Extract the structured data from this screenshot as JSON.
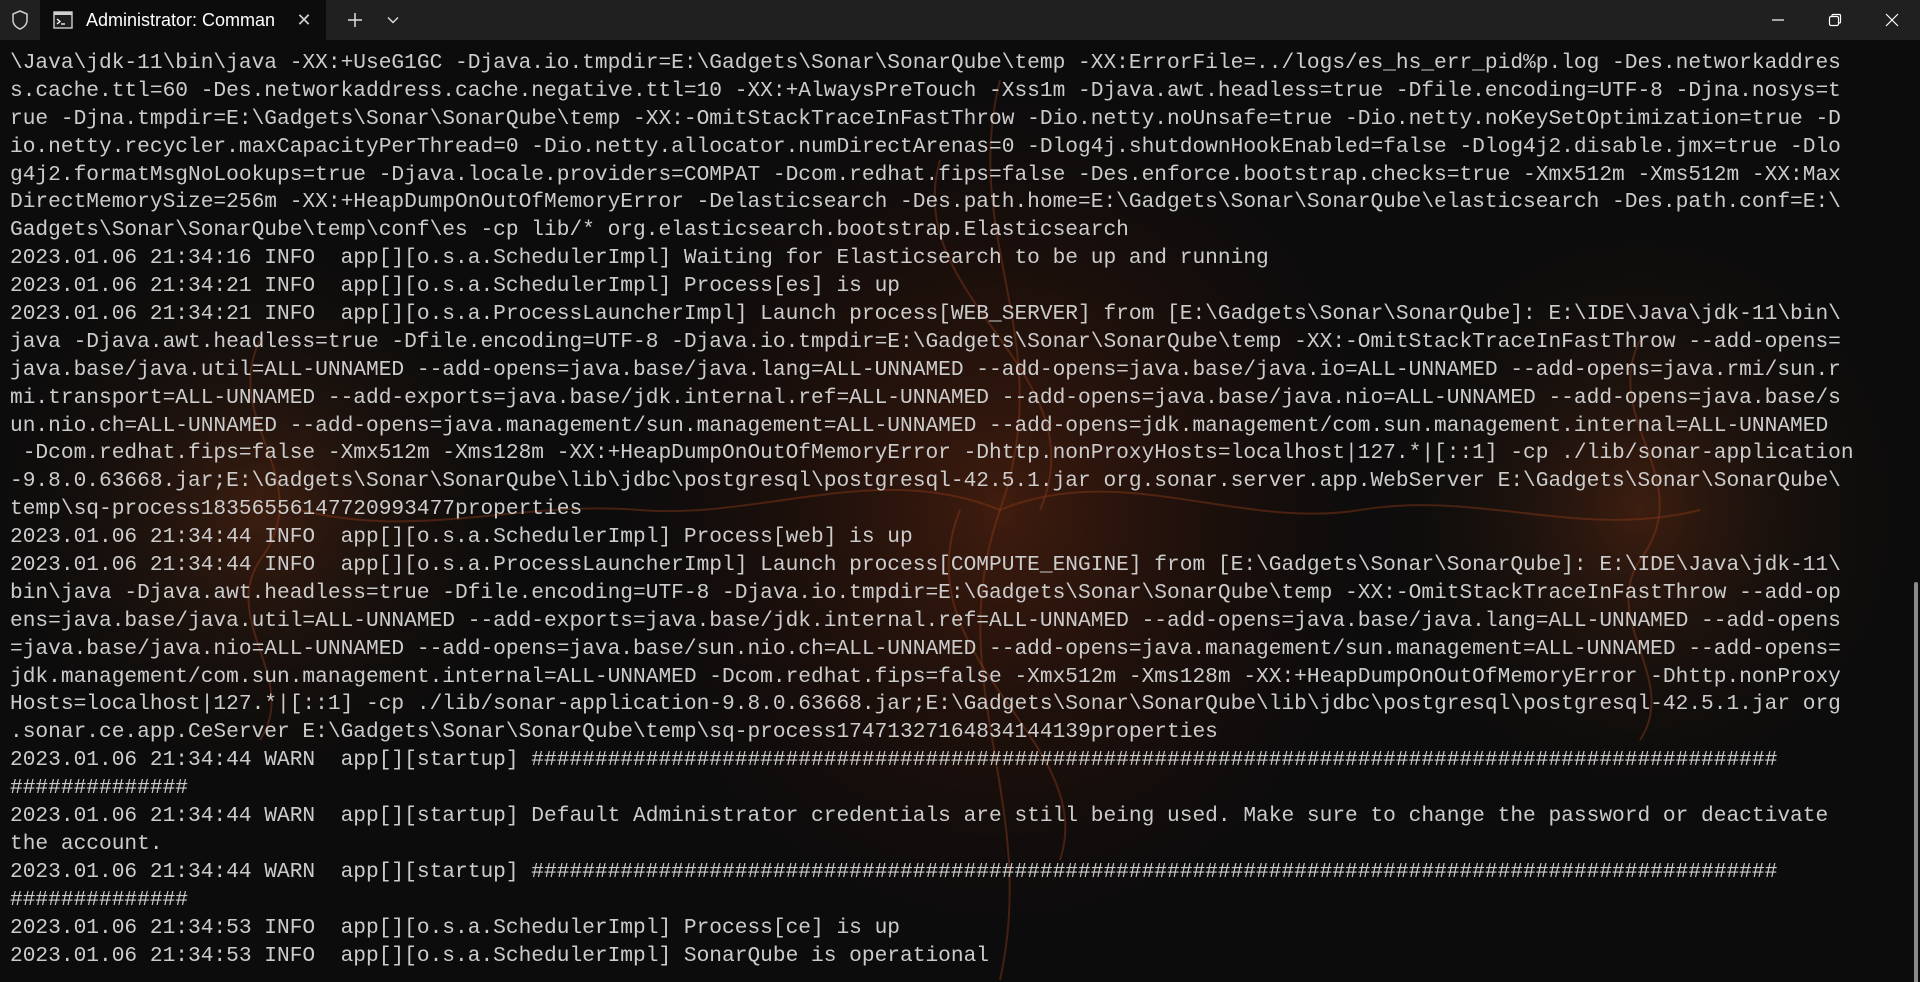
{
  "window": {
    "tab_title": "Administrator: Comman",
    "tab_close_glyph": "✕",
    "icons": {
      "shield": "shield-icon",
      "terminal": "command-prompt-icon",
      "new_tab": "plus-icon",
      "dropdown": "chevron-down-icon",
      "minimize": "minimize-icon",
      "restore": "restore-icon",
      "close": "close-icon"
    }
  },
  "terminal": {
    "foreground": "#cccccc",
    "background": "#0c0c0c",
    "lines": [
      "\\Java\\jdk-11\\bin\\java -XX:+UseG1GC -Djava.io.tmpdir=E:\\Gadgets\\Sonar\\SonarQube\\temp -XX:ErrorFile=../logs/es_hs_err_pid%p.log -Des.networkaddres",
      "s.cache.ttl=60 -Des.networkaddress.cache.negative.ttl=10 -XX:+AlwaysPreTouch -Xss1m -Djava.awt.headless=true -Dfile.encoding=UTF-8 -Djna.nosys=t",
      "rue -Djna.tmpdir=E:\\Gadgets\\Sonar\\SonarQube\\temp -XX:-OmitStackTraceInFastThrow -Dio.netty.noUnsafe=true -Dio.netty.noKeySetOptimization=true -D",
      "io.netty.recycler.maxCapacityPerThread=0 -Dio.netty.allocator.numDirectArenas=0 -Dlog4j.shutdownHookEnabled=false -Dlog4j2.disable.jmx=true -Dlo",
      "g4j2.formatMsgNoLookups=true -Djava.locale.providers=COMPAT -Dcom.redhat.fips=false -Des.enforce.bootstrap.checks=true -Xmx512m -Xms512m -XX:Max",
      "DirectMemorySize=256m -XX:+HeapDumpOnOutOfMemoryError -Delasticsearch -Des.path.home=E:\\Gadgets\\Sonar\\SonarQube\\elasticsearch -Des.path.conf=E:\\",
      "Gadgets\\Sonar\\SonarQube\\temp\\conf\\es -cp lib/* org.elasticsearch.bootstrap.Elasticsearch",
      "2023.01.06 21:34:16 INFO  app[][o.s.a.SchedulerImpl] Waiting for Elasticsearch to be up and running",
      "2023.01.06 21:34:21 INFO  app[][o.s.a.SchedulerImpl] Process[es] is up",
      "2023.01.06 21:34:21 INFO  app[][o.s.a.ProcessLauncherImpl] Launch process[WEB_SERVER] from [E:\\Gadgets\\Sonar\\SonarQube]: E:\\IDE\\Java\\jdk-11\\bin\\",
      "java -Djava.awt.headless=true -Dfile.encoding=UTF-8 -Djava.io.tmpdir=E:\\Gadgets\\Sonar\\SonarQube\\temp -XX:-OmitStackTraceInFastThrow --add-opens=",
      "java.base/java.util=ALL-UNNAMED --add-opens=java.base/java.lang=ALL-UNNAMED --add-opens=java.base/java.io=ALL-UNNAMED --add-opens=java.rmi/sun.r",
      "mi.transport=ALL-UNNAMED --add-exports=java.base/jdk.internal.ref=ALL-UNNAMED --add-opens=java.base/java.nio=ALL-UNNAMED --add-opens=java.base/s",
      "un.nio.ch=ALL-UNNAMED --add-opens=java.management/sun.management=ALL-UNNAMED --add-opens=jdk.management/com.sun.management.internal=ALL-UNNAMED",
      " -Dcom.redhat.fips=false -Xmx512m -Xms128m -XX:+HeapDumpOnOutOfMemoryError -Dhttp.nonProxyHosts=localhost|127.*|[::1] -cp ./lib/sonar-application",
      "-9.8.0.63668.jar;E:\\Gadgets\\Sonar\\SonarQube\\lib\\jdbc\\postgresql\\postgresql-42.5.1.jar org.sonar.server.app.WebServer E:\\Gadgets\\Sonar\\SonarQube\\",
      "temp\\sq-process18356556147720993477properties",
      "2023.01.06 21:34:44 INFO  app[][o.s.a.SchedulerImpl] Process[web] is up",
      "2023.01.06 21:34:44 INFO  app[][o.s.a.ProcessLauncherImpl] Launch process[COMPUTE_ENGINE] from [E:\\Gadgets\\Sonar\\SonarQube]: E:\\IDE\\Java\\jdk-11\\",
      "bin\\java -Djava.awt.headless=true -Dfile.encoding=UTF-8 -Djava.io.tmpdir=E:\\Gadgets\\Sonar\\SonarQube\\temp -XX:-OmitStackTraceInFastThrow --add-op",
      "ens=java.base/java.util=ALL-UNNAMED --add-exports=java.base/jdk.internal.ref=ALL-UNNAMED --add-opens=java.base/java.lang=ALL-UNNAMED --add-opens",
      "=java.base/java.nio=ALL-UNNAMED --add-opens=java.base/sun.nio.ch=ALL-UNNAMED --add-opens=java.management/sun.management=ALL-UNNAMED --add-opens=",
      "jdk.management/com.sun.management.internal=ALL-UNNAMED -Dcom.redhat.fips=false -Xmx512m -Xms128m -XX:+HeapDumpOnOutOfMemoryError -Dhttp.nonProxy",
      "Hosts=localhost|127.*|[::1] -cp ./lib/sonar-application-9.8.0.63668.jar;E:\\Gadgets\\Sonar\\SonarQube\\lib\\jdbc\\postgresql\\postgresql-42.5.1.jar org",
      ".sonar.ce.app.CeServer E:\\Gadgets\\Sonar\\SonarQube\\temp\\sq-process17471327164834144139properties",
      "2023.01.06 21:34:44 WARN  app[][startup] ##################################################################################################",
      "##############",
      "2023.01.06 21:34:44 WARN  app[][startup] Default Administrator credentials are still being used. Make sure to change the password or deactivate",
      "the account.",
      "2023.01.06 21:34:44 WARN  app[][startup] ##################################################################################################",
      "##############",
      "2023.01.06 21:34:53 INFO  app[][o.s.a.SchedulerImpl] Process[ce] is up",
      "2023.01.06 21:34:53 INFO  app[][o.s.a.SchedulerImpl] SonarQube is operational"
    ]
  }
}
